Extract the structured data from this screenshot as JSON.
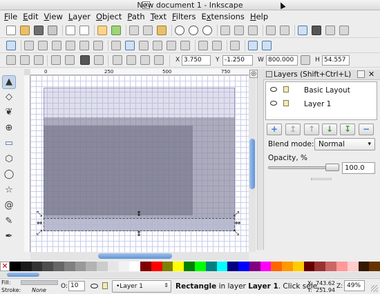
{
  "window": {
    "title": "New document 1 - Inkscape"
  },
  "menu": [
    "File",
    "Edit",
    "View",
    "Layer",
    "Object",
    "Path",
    "Text",
    "Filters",
    "Extensions",
    "Help"
  ],
  "menu_underline": [
    "F",
    "E",
    "V",
    "L",
    "O",
    "P",
    "T",
    "F",
    "x",
    "H"
  ],
  "commands_toolbar": {
    "icons": [
      "new-document-icon",
      "open-icon",
      "save-icon",
      "print-icon",
      "import-icon",
      "export-icon",
      "undo-icon",
      "redo-icon",
      "copy-icon",
      "cut-icon",
      "paste-icon",
      "zoom-selection-icon",
      "zoom-drawing-icon",
      "zoom-page-icon",
      "duplicate-icon",
      "clone-icon",
      "unlink-clone-icon",
      "group-icon",
      "ungroup-icon",
      "fill-stroke-icon",
      "text-font-icon",
      "xml-editor-icon",
      "preferences-icon"
    ]
  },
  "node_toolbar": {
    "icons": [
      "node-tool-icon",
      "insert-node-icon",
      "delete-node-icon",
      "join-nodes-icon",
      "break-path-icon",
      "join-segment-icon",
      "delete-segment-icon",
      "make-cusp-icon",
      "make-smooth-icon",
      "make-symmetric-icon",
      "make-auto-icon",
      "line-segment-icon",
      "curve-segment-icon",
      "object-to-path-icon",
      "stroke-to-path-icon",
      "show-clip-icon",
      "show-handles-icon",
      "show-outline-icon"
    ]
  },
  "selector_toolbar": {
    "x_label": "X",
    "x_value": "3.750",
    "y_label": "Y",
    "y_value": "-1.250",
    "w_label": "W",
    "w_value": "800.000",
    "h_label": "H",
    "h_value": "54.557"
  },
  "ruler": {
    "ticks": [
      "0",
      "250",
      "500",
      "750"
    ]
  },
  "layers_panel": {
    "title": "Layers (Shift+Ctrl+L)",
    "layers": [
      "Basic Layout",
      "Layer 1"
    ],
    "blend_label": "Blend mode:",
    "blend_value": "Normal",
    "opacity_label": "Opacity, %",
    "opacity_value": "100.0",
    "opacity_level": 1.0
  },
  "palette": [
    "#000000",
    "#1a1a1a",
    "#333333",
    "#4d4d4d",
    "#666666",
    "#808080",
    "#999999",
    "#b3b3b3",
    "#cccccc",
    "#e6e6e6",
    "#f2f2f2",
    "#ffffff",
    "#800000",
    "#ff0000",
    "#808000",
    "#ffff00",
    "#008000",
    "#00ff00",
    "#008080",
    "#00ffff",
    "#000080",
    "#0000ff",
    "#800080",
    "#ff00ff",
    "#ff6600",
    "#ff9900",
    "#ffcc00",
    "#660000",
    "#993333",
    "#cc6666",
    "#ff9999",
    "#ffcccc",
    "#331a00",
    "#663300"
  ],
  "status": {
    "fill_label": "Fill:",
    "stroke_label": "Stroke:",
    "stroke_value": "None",
    "opacity_label": "O:",
    "opacity_value": "10",
    "layer_value": "•Layer 1",
    "message_bold1": "Rectangle",
    "message_mid": " in layer ",
    "message_bold2": "Layer 1",
    "message_end": ". Click sele...",
    "x_label": "X:",
    "x_value": "743.62",
    "y_label": "Y:",
    "y_value": "251.94",
    "zoom_label": "Z:",
    "zoom_value": "49%"
  }
}
